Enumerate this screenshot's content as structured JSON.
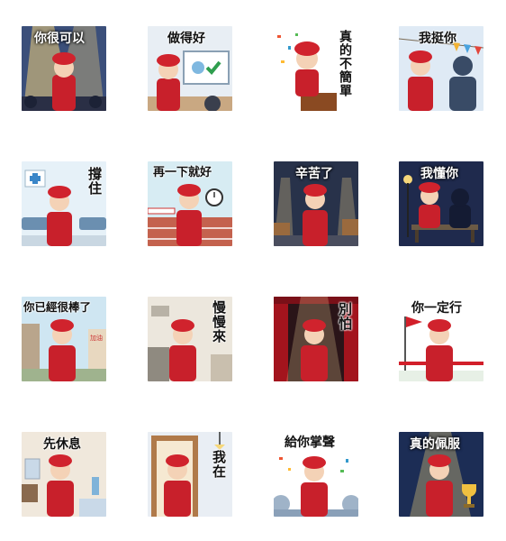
{
  "stickers": [
    {
      "text": "你很可以",
      "theme": "stage-spotlight",
      "colors": [
        "#3b4f7a",
        "#f3d27a"
      ]
    },
    {
      "text": "做得好",
      "theme": "office-board",
      "colors": [
        "#e8eef4",
        "#c9dbe6"
      ]
    },
    {
      "text": "真的不簡單",
      "theme": "podium-confetti",
      "colors": [
        "#ffffff",
        "#f4f4f4"
      ]
    },
    {
      "text": "我挺你",
      "theme": "festive-flags",
      "colors": [
        "#dfeaf5",
        "#a9c4e2"
      ]
    },
    {
      "text": "撐住",
      "theme": "hospital-waiting",
      "colors": [
        "#e6f1f8",
        "#bcd8ea"
      ]
    },
    {
      "text": "再一下就好",
      "theme": "running-track",
      "colors": [
        "#d7ecf3",
        "#c4624e"
      ]
    },
    {
      "text": "辛苦了",
      "theme": "night-warehouse",
      "colors": [
        "#28324a",
        "#4a4e5e"
      ]
    },
    {
      "text": "我懂你",
      "theme": "park-night-bench",
      "colors": [
        "#1f2a4d",
        "#6b5a45"
      ]
    },
    {
      "text": "你已經很棒了",
      "theme": "street-buildings",
      "colors": [
        "#cfe6f2",
        "#dfe8d8"
      ]
    },
    {
      "text": "慢慢來",
      "theme": "kitchen",
      "colors": [
        "#ece7dd",
        "#c9bfae"
      ]
    },
    {
      "text": "別怕",
      "theme": "red-curtain-stage",
      "colors": [
        "#7a1018",
        "#2a1418"
      ]
    },
    {
      "text": "你一定行",
      "theme": "finish-line",
      "colors": [
        "#ffffff",
        "#e7f0e6"
      ]
    },
    {
      "text": "先休息",
      "theme": "bedroom",
      "colors": [
        "#f0e8dc",
        "#c9d9e8"
      ]
    },
    {
      "text": "我在",
      "theme": "doorway",
      "colors": [
        "#e9eef4",
        "#b07a4a"
      ]
    },
    {
      "text": "給你掌聲",
      "theme": "audience-confetti",
      "colors": [
        "#ffffff",
        "#9fb3c8"
      ]
    },
    {
      "text": "真的佩服",
      "theme": "trophy-spotlight",
      "colors": [
        "#1c2d55",
        "#f0d57a"
      ]
    }
  ]
}
